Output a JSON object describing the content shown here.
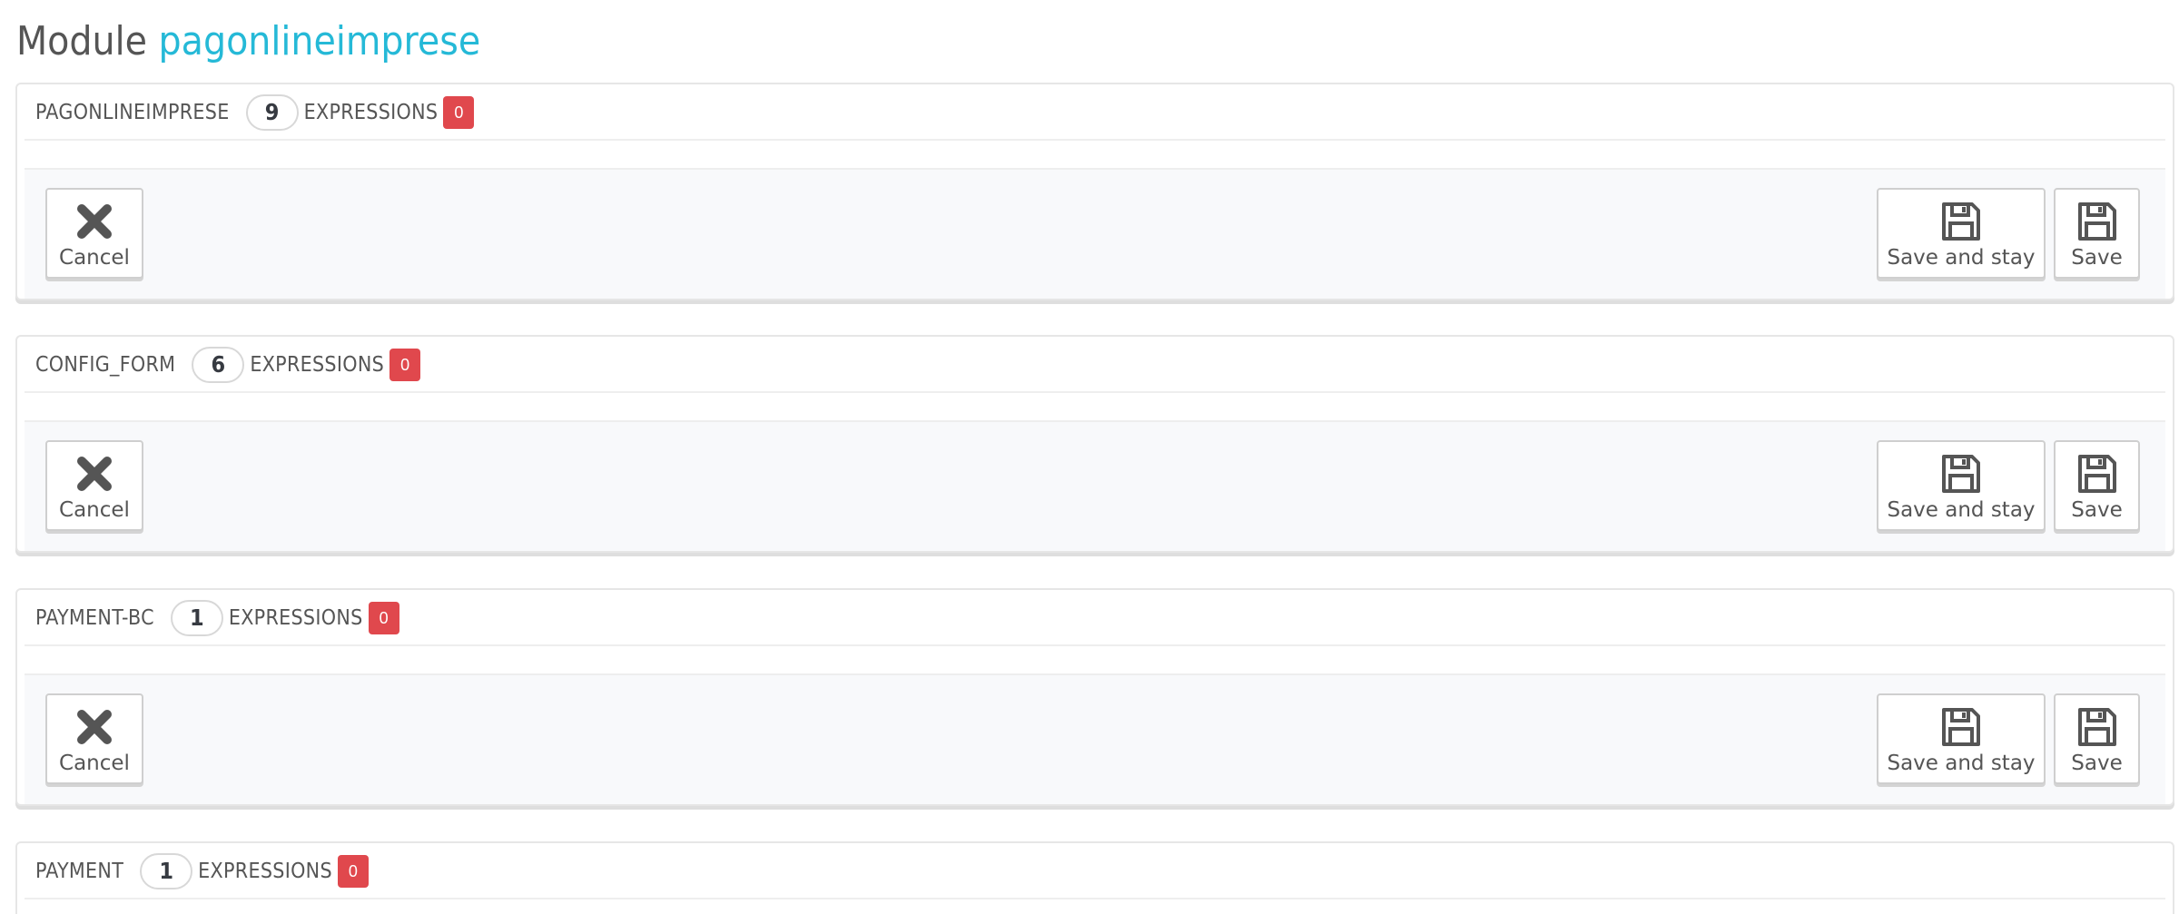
{
  "page": {
    "title_prefix": "Module",
    "module_name": "pagonlineimprese"
  },
  "panels": [
    {
      "name": "PAGONLINEIMPRESE",
      "count": "9",
      "expressions_label": "EXPRESSIONS",
      "expressions_count": "0"
    },
    {
      "name": "CONFIG_FORM",
      "count": "6",
      "expressions_label": "EXPRESSIONS",
      "expressions_count": "0"
    },
    {
      "name": "PAYMENT-BC",
      "count": "1",
      "expressions_label": "EXPRESSIONS",
      "expressions_count": "0"
    },
    {
      "name": "PAYMENT",
      "count": "1",
      "expressions_label": "EXPRESSIONS",
      "expressions_count": "0"
    }
  ],
  "buttons": {
    "cancel_label": "Cancel",
    "save_and_stay_label": "Save and stay",
    "save_label": "Save"
  },
  "icons": {
    "cancel": "close-icon",
    "save": "floppy-disk-icon"
  },
  "colors": {
    "accent": "#25b9d7",
    "danger_badge": "#e0484d",
    "text": "#555555"
  }
}
